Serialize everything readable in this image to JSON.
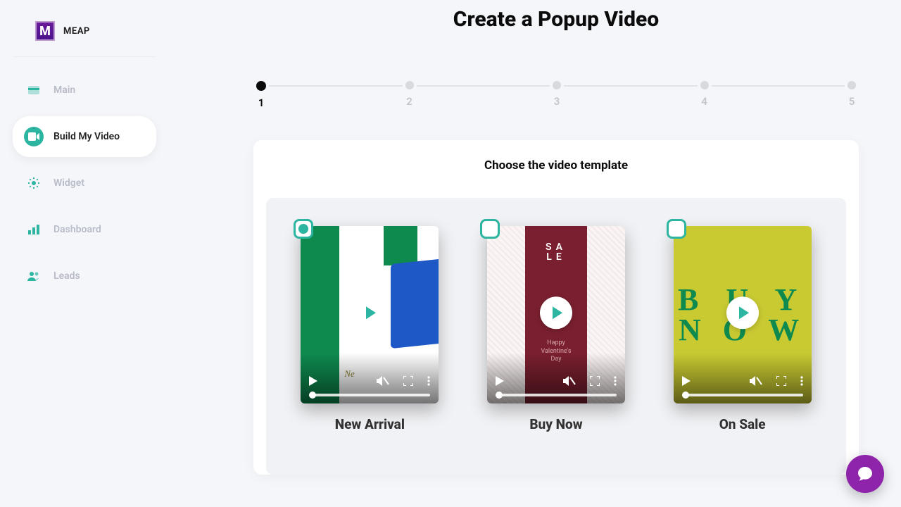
{
  "brand": {
    "mark": "M",
    "name": "MEAP"
  },
  "sidebar": {
    "items": [
      {
        "label": "Main"
      },
      {
        "label": "Build My Video"
      },
      {
        "label": "Widget"
      },
      {
        "label": "Dashboard"
      },
      {
        "label": "Leads"
      }
    ]
  },
  "page": {
    "title": "Create a Popup Video"
  },
  "stepper": {
    "steps": [
      "1",
      "2",
      "3",
      "4",
      "5"
    ],
    "active": 0
  },
  "section": {
    "title": "Choose the video template"
  },
  "templates": [
    {
      "name": "New Arrival",
      "selected": true,
      "overlay_text": "Ne"
    },
    {
      "name": "Buy Now",
      "selected": false,
      "band_top": "SA",
      "band_bottom": "LE",
      "sub1": "Happy",
      "sub2": "Valentine's",
      "sub3": "Day"
    },
    {
      "name": "On Sale",
      "selected": false,
      "l1": "B U Y",
      "l2": "N O W"
    }
  ]
}
